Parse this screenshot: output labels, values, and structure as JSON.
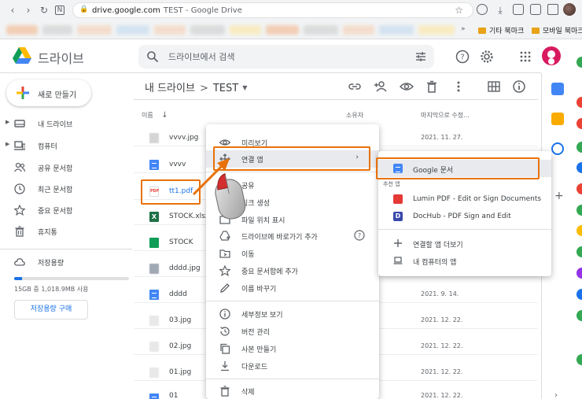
{
  "browser": {
    "url_domain": "drive.google.com",
    "url_title": "TEST - Google Drive",
    "bookmarks_folder1": "기타 북마크",
    "bookmarks_folder2": "모바일 북마크",
    "bookmarks_more": "»"
  },
  "header": {
    "app_name": "드라이브",
    "search_placeholder": "드라이브에서 검색"
  },
  "sidebar": {
    "new_button": "새로 만들기",
    "items": [
      {
        "label": "내 드라이브",
        "icon": "my-drive-icon"
      },
      {
        "label": "컴퓨터",
        "icon": "computer-icon"
      },
      {
        "label": "공유 문서함",
        "icon": "shared-icon"
      },
      {
        "label": "최근 문서함",
        "icon": "recent-icon"
      },
      {
        "label": "중요 문서함",
        "icon": "star-icon"
      },
      {
        "label": "휴지통",
        "icon": "trash-icon"
      }
    ],
    "storage_label": "저장용량",
    "storage_usage": "15GB 중 1,018.9MB 사용",
    "storage_fraction": 0.066,
    "buy_storage": "저장용량 구매"
  },
  "main": {
    "breadcrumb_root": "내 드라이브",
    "breadcrumb_sep": ">",
    "breadcrumb_current": "TEST",
    "columns": {
      "name": "이름",
      "sort_arrow": "↓",
      "owner": "소유자",
      "modified": "마지막으로 수정..."
    },
    "files": [
      {
        "name": "vvvv.jpg",
        "type": "image",
        "date": "2021. 11. 27."
      },
      {
        "name": "vvvv",
        "type": "doc",
        "date": ""
      },
      {
        "name": "tt1.pdf",
        "type": "pdf",
        "date": ""
      },
      {
        "name": "STOCK.xlsx",
        "type": "xlsx",
        "date": ""
      },
      {
        "name": "STOCK",
        "type": "sheet",
        "date": ""
      },
      {
        "name": "dddd.jpg",
        "type": "image",
        "date": ""
      },
      {
        "name": "dddd",
        "type": "doc",
        "date": "2021. 9. 14."
      },
      {
        "name": "03.jpg",
        "type": "image",
        "date": "2021. 12. 22."
      },
      {
        "name": "02.jpg",
        "type": "image",
        "date": "2021. 12. 22."
      },
      {
        "name": "01.jpg",
        "type": "image",
        "date": "2021. 12. 22."
      },
      {
        "name": "01",
        "type": "doc",
        "date": "2021. 12. 22."
      }
    ]
  },
  "context_menu": {
    "items": [
      {
        "label": "미리보기",
        "icon": "eye-icon"
      },
      {
        "label": "연결 앱",
        "icon": "move-arrows-icon"
      },
      {
        "label": "공유",
        "icon": "share-icon"
      },
      {
        "label": "링크 생성",
        "icon": "link-icon"
      },
      {
        "label": "파일 위치 표시",
        "icon": "folder-icon"
      },
      {
        "label": "드라이브에 바로가기 추가",
        "icon": "shortcut-icon"
      },
      {
        "label": "이동",
        "icon": "move-icon"
      },
      {
        "label": "중요 문서함에 추가",
        "icon": "star-icon"
      },
      {
        "label": "이름 바꾸기",
        "icon": "pencil-icon"
      },
      {
        "label": "세부정보 보기",
        "icon": "info-icon"
      },
      {
        "label": "버전 관리",
        "icon": "history-icon"
      },
      {
        "label": "사본 만들기",
        "icon": "copy-icon"
      },
      {
        "label": "다운로드",
        "icon": "download-icon"
      },
      {
        "label": "삭제",
        "icon": "trash-icon"
      }
    ],
    "submenu_arrow": "›"
  },
  "submenu": {
    "google_docs": "Google 문서",
    "suggested_label": "추천 앱",
    "apps": [
      {
        "label": "Lumin PDF - Edit or Sign Documents",
        "color": "#e53935"
      },
      {
        "label": "DocHub - PDF Sign and Edit",
        "color": "#3949ab"
      }
    ],
    "more_apps": "연결할 앱 더보기",
    "computer_apps": "내 컴퓨터의 앱"
  },
  "colors": {
    "accent": "#1a73e8",
    "highlight": "#e8710a"
  }
}
